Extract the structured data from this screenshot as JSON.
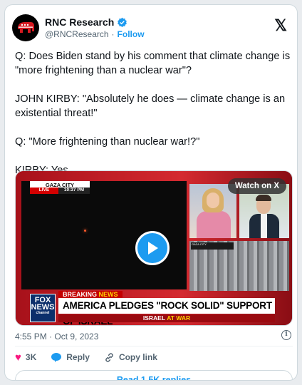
{
  "author": {
    "name": "RNC Research",
    "handle": "@RNCResearch",
    "separator": "·",
    "follow_label": "Follow",
    "x_logo": "𝕏"
  },
  "tweet": {
    "text": "Q: Does Biden stand by his comment that climate change is \"more frightening than a nuclear war\"?\n\nJOHN KIRBY: \"Absolutely he does — climate change is an existential threat!\"\n\nQ: \"More frightening than nuclear war!?\"\n\nKIRBY: Yes",
    "timestamp": "4:55 PM · Oct 9, 2023"
  },
  "video": {
    "watch_label": "Watch on X",
    "location_tag": "GAZA CITY",
    "live_label": "LIVE",
    "time_label": "10:37 PM",
    "breaking_prefix": "BREAKING",
    "breaking_suffix": "NEWS",
    "headline": "AMERICA PLEDGES \"ROCK SOLID\" SUPPORT OF ISRAEL",
    "subline_a": "ISRAEL",
    "subline_b": "AT WAR",
    "network_logo": "FOX",
    "network_logo_2": "NEWS",
    "network_logo_3": "channel",
    "inset_caption": "GAZA CITY"
  },
  "actions": {
    "like_count": "3K",
    "reply_label": "Reply",
    "copy_label": "Copy link",
    "read_replies_label": "Read 1.5K replies"
  },
  "colors": {
    "accent": "#1d9bf0",
    "like": "#f91880",
    "fox_red": "#c40000"
  },
  "icons": [
    "elephant-logo-icon",
    "verified-badge-icon",
    "x-logo-icon",
    "play-icon",
    "info-icon",
    "heart-icon",
    "reply-icon",
    "link-icon"
  ]
}
